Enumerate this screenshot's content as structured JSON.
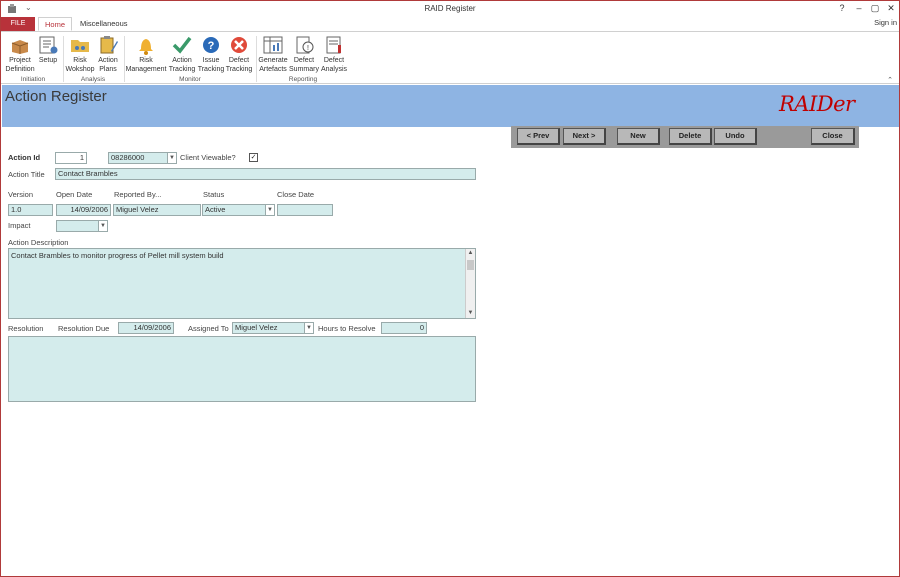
{
  "window": {
    "title": "RAID Register",
    "help": "?",
    "minimize": "–",
    "maximize": "▢",
    "close": "✕",
    "qat": "⌄"
  },
  "tabs": {
    "file": "FILE",
    "home": "Home",
    "misc": "Miscellaneous",
    "signin": "Sign in"
  },
  "ribbon": {
    "buttons": [
      {
        "line1": "Project",
        "line2": "Definition"
      },
      {
        "line1": "Setup",
        "line2": ""
      },
      {
        "line1": "Risk",
        "line2": "Wokshop"
      },
      {
        "line1": "Action",
        "line2": "Plans"
      },
      {
        "line1": "Risk",
        "line2": "Management"
      },
      {
        "line1": "Action",
        "line2": "Tracking"
      },
      {
        "line1": "Issue",
        "line2": "Tracking"
      },
      {
        "line1": "Defect",
        "line2": "Tracking"
      },
      {
        "line1": "Generate",
        "line2": "Artefacts"
      },
      {
        "line1": "Defect",
        "line2": "Summary"
      },
      {
        "line1": "Defect",
        "line2": "Analysis"
      }
    ],
    "groups": {
      "initiation": "Initiation",
      "analysis": "Analysis",
      "monitor": "Monitor",
      "reporting": "Reporting"
    },
    "collapse": "⌃"
  },
  "form": {
    "title": "Action Register",
    "logo": "RAIDer",
    "nav": {
      "prev": "< Prev",
      "next": "Next >",
      "new": "New",
      "delete": "Delete",
      "undo": "Undo",
      "close": "Close"
    },
    "labels": {
      "action_id": "Action Id",
      "client_viewable": "Client Viewable?",
      "action_title": "Action Title",
      "version": "Version",
      "open_date": "Open Date",
      "reported_by": "Reported By...",
      "status": "Status",
      "close_date": "Close Date",
      "impact": "Impact",
      "action_description": "Action Description",
      "resolution": "Resolution",
      "resolution_due": "Resolution Due",
      "assigned_to": "Assigned To",
      "hours_to_resolve": "Hours to Resolve"
    },
    "values": {
      "action_id": "1",
      "project_code": "08286000",
      "client_viewable_check": "✓",
      "action_title": "Contact Brambles",
      "version": "1.0",
      "open_date": "14/09/2006",
      "reported_by": "Miguel Velez",
      "status": "Active",
      "close_date": "",
      "impact": "",
      "action_description": "Contact Brambles to monitor progress of Pellet mill system build",
      "resolution_due": "14/09/2006",
      "assigned_to": "Miguel Velez",
      "hours_to_resolve": "0",
      "resolution": ""
    }
  },
  "colors": {
    "accent": "#b8323a",
    "header_band": "#8eb4e3",
    "field_bg": "#d4ecec",
    "logo": "#c00000"
  }
}
